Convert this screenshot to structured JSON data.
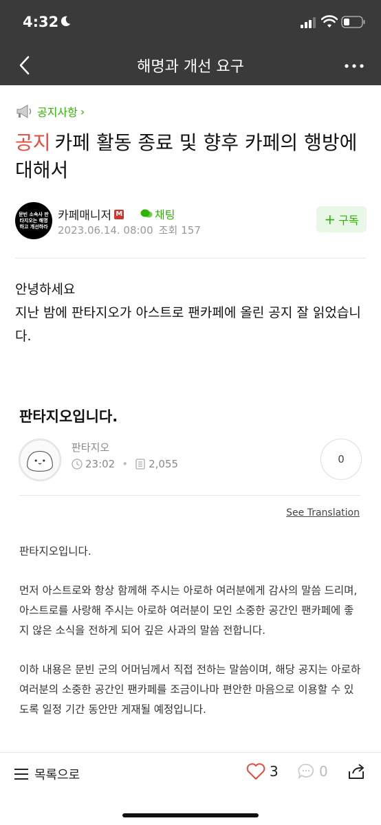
{
  "status": {
    "time": "4:32"
  },
  "header": {
    "title": "해명과 개선 요구"
  },
  "post": {
    "board": "공지사항",
    "tag": "공지",
    "title": "카페 활동 종료 및 향후 카페의 행방에 대해서",
    "author_avatar_text": "문빈 소속사 판타지오는 해명하고 개선하라",
    "author": "카페매니저",
    "manager_badge": "M",
    "chat_label": "채팅",
    "date": "2023.06.14. 08:00",
    "views_label": "조회",
    "views": "157",
    "subscribe_label": "구독",
    "body_line1": "안녕하세요",
    "body_line2": "지난 밤에 판타지오가 아스트로 팬카페에 올린 공지 잘 읽었습니다."
  },
  "embed": {
    "title": "판타지오입니다.",
    "name": "판타지오",
    "time": "23:02",
    "views": "2,055",
    "count": "0",
    "see_translation": "See Translation",
    "paragraphs": [
      "판타지오입니다.",
      "먼저 아스트로와 항상 함께해 주시는 아로하 여러분에게 감사의 말씀 드리며, 아스트로를 사랑해 주시는 아로하 여러분이 모인 소중한 공간인 팬카페에 좋지 않은 소식을 전하게 되어 깊은 사과의 말씀 전합니다.",
      "이하 내용은 문빈 군의 어머님께서 직접 전하는 말씀이며, 해당 공지는 아로하 여러분의 소중한 공간인 팬카페를 조금이나마 편안한 마음으로 이용할 수 있도록 일정 기간 동안만 게재될 예정입니다."
    ]
  },
  "bottom": {
    "list_label": "목록으로",
    "likes": "3",
    "comments": "0"
  },
  "colors": {
    "brand_green": "#2db400",
    "notice_red": "#e8483a",
    "header_bg": "#3a3a3a"
  }
}
